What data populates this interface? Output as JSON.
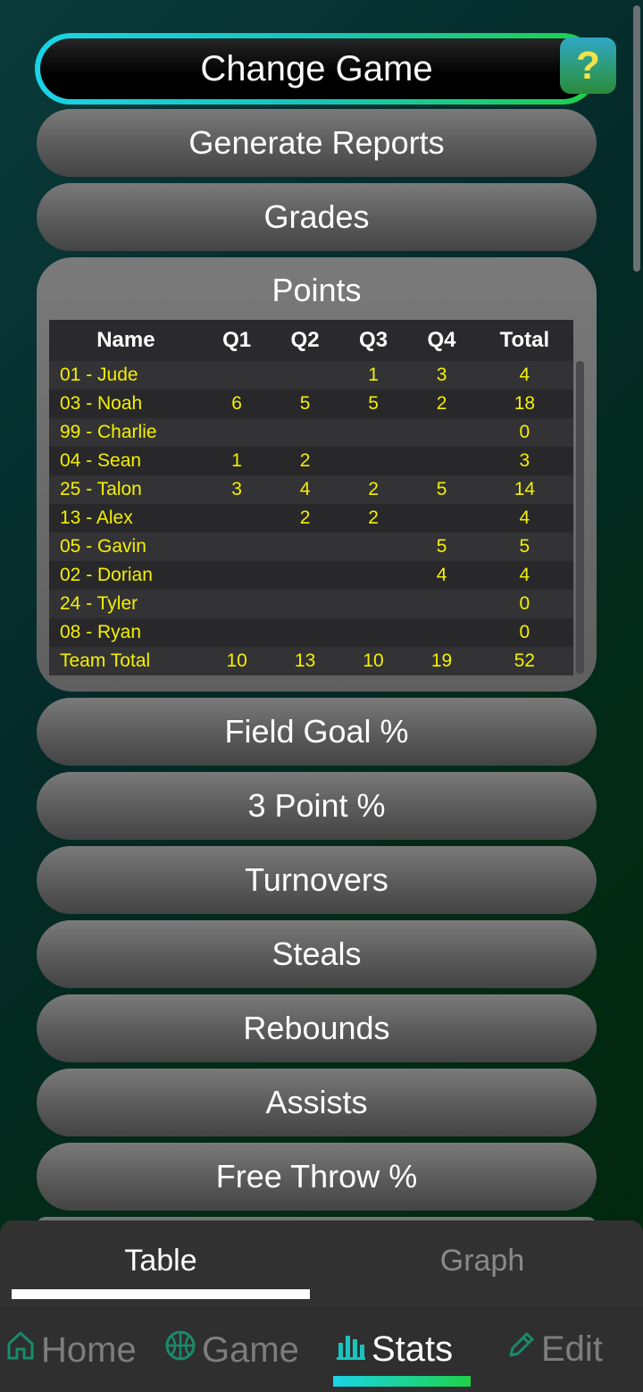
{
  "header": {
    "change_game": "Change Game",
    "help": "?"
  },
  "menu": {
    "generate_reports": "Generate Reports",
    "grades": "Grades",
    "field_goal": "Field Goal %",
    "three_point": "3 Point %",
    "turnovers": "Turnovers",
    "steals": "Steals",
    "rebounds": "Rebounds",
    "assists": "Assists",
    "free_throw": "Free Throw %"
  },
  "points": {
    "title": "Points",
    "columns": [
      "Name",
      "Q1",
      "Q2",
      "Q3",
      "Q4",
      "Total"
    ],
    "rows": [
      [
        "01 - Jude",
        "",
        "",
        "1",
        "3",
        "4"
      ],
      [
        "03 - Noah",
        "6",
        "5",
        "5",
        "2",
        "18"
      ],
      [
        "99 - Charlie",
        "",
        "",
        "",
        "",
        "0"
      ],
      [
        "04 - Sean",
        "1",
        "2",
        "",
        "",
        "3"
      ],
      [
        "25 - Talon",
        "3",
        "4",
        "2",
        "5",
        "14"
      ],
      [
        "13 - Alex",
        "",
        "2",
        "2",
        "",
        "4"
      ],
      [
        "05 - Gavin",
        "",
        "",
        "",
        "5",
        "5"
      ],
      [
        "02 - Dorian",
        "",
        "",
        "",
        "4",
        "4"
      ],
      [
        "24 - Tyler",
        "",
        "",
        "",
        "",
        "0"
      ],
      [
        "08 - Ryan",
        "",
        "",
        "",
        "",
        "0"
      ],
      [
        "Team Total",
        "10",
        "13",
        "10",
        "19",
        "52"
      ]
    ]
  },
  "view_tabs": {
    "table": "Table",
    "graph": "Graph"
  },
  "nav": {
    "home": "Home",
    "game": "Game",
    "stats": "Stats",
    "edit": "Edit"
  },
  "colors": {
    "accent_start": "#1ad4e6",
    "accent_end": "#1ed24a",
    "table_text": "#f4f000"
  }
}
